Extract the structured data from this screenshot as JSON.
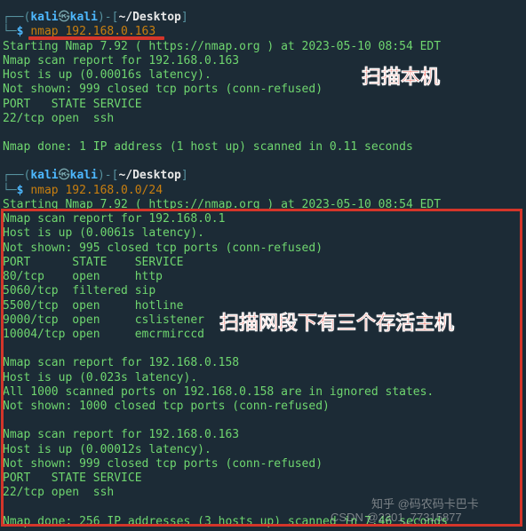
{
  "prompt": {
    "user": "kali",
    "at": "㉿",
    "host": "kali",
    "path": "~/Desktop",
    "dollar": "$"
  },
  "commands": {
    "cmd1": "nmap 192.168.0.163",
    "cmd2": "nmap 192.168.0.0/24"
  },
  "block1": {
    "l1": "Starting Nmap 7.92 ( https://nmap.org ) at 2023-05-10 08:54 EDT",
    "l2": "Nmap scan report for 192.168.0.163",
    "l3": "Host is up (0.00016s latency).",
    "l4": "Not shown: 999 closed tcp ports (conn-refused)",
    "l5": "PORT   STATE SERVICE",
    "l6": "22/tcp open  ssh",
    "l7": "Nmap done: 1 IP address (1 host up) scanned in 0.11 seconds"
  },
  "block2": {
    "l1": "Starting Nmap 7.92 ( https://nmap.org ) at 2023-05-10 08:54 EDT",
    "l2": "Nmap scan report for 192.168.0.1",
    "l3": "Host is up (0.0061s latency).",
    "l4": "Not shown: 995 closed tcp ports (conn-refused)",
    "l5": "PORT      STATE    SERVICE",
    "l6": "80/tcp    open     http",
    "l7": "5060/tcp  filtered sip",
    "l8": "5500/tcp  open     hotline",
    "l9": "9000/tcp  open     cslistener",
    "l10": "10004/tcp open     emcrmirccd",
    "l11": "Nmap scan report for 192.168.0.158",
    "l12": "Host is up (0.023s latency).",
    "l13": "All 1000 scanned ports on 192.168.0.158 are in ignored states.",
    "l14": "Not shown: 1000 closed tcp ports (conn-refused)",
    "l15": "Nmap scan report for 192.168.0.163",
    "l16": "Host is up (0.00012s latency).",
    "l17": "Not shown: 999 closed tcp ports (conn-refused)",
    "l18": "PORT   STATE SERVICE",
    "l19": "22/tcp open  ssh",
    "l20": "Nmap done: 256 IP addresses (3 hosts up) scanned in 7.46 seconds"
  },
  "annotations": {
    "a1": "扫描本机",
    "a2": "扫描网段下有三个存活主机"
  },
  "watermarks": {
    "w1": "知乎 @码农码卡巴卡",
    "w2": "CSDN @2301_77315877"
  }
}
